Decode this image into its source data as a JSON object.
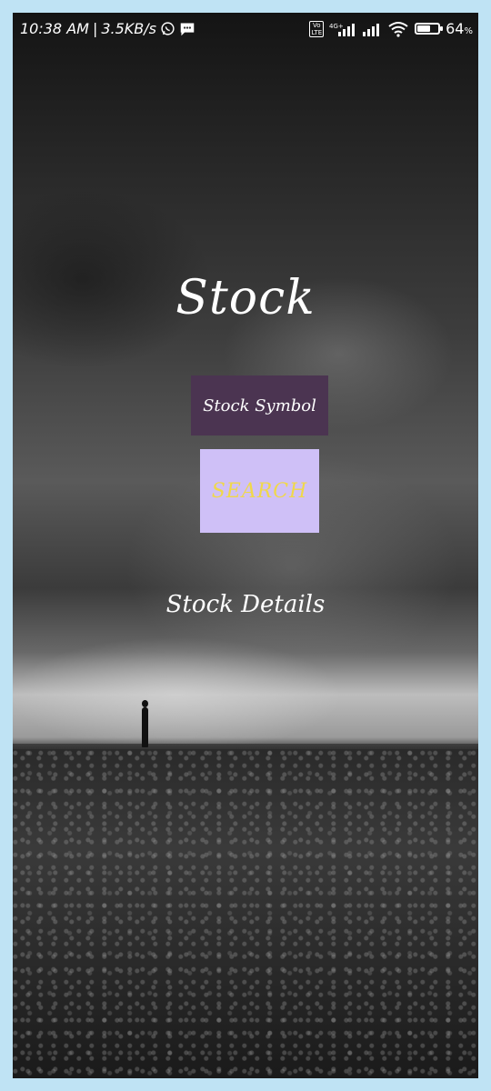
{
  "status_bar": {
    "time": "10:38 AM",
    "network_speed": "3.5KB/s",
    "volte_label": "Vo\nLTE",
    "network_type": "4G+",
    "battery_percent": "64",
    "battery_level": 0.64,
    "icons": [
      "whatsapp-icon",
      "message-icon",
      "volte-icon",
      "signal-icon",
      "signal-icon",
      "wifi-icon",
      "battery-icon"
    ]
  },
  "main": {
    "title": "Stock",
    "symbol_input": {
      "value": "",
      "placeholder": "Stock Symbol"
    },
    "search_button_label": "SEARCH",
    "details_text": "Stock Details"
  },
  "colors": {
    "input_bg": "#4b3451",
    "button_bg": "#cfc0f7",
    "button_text": "#f0d84a",
    "frame_border": "#bfe3f4"
  }
}
